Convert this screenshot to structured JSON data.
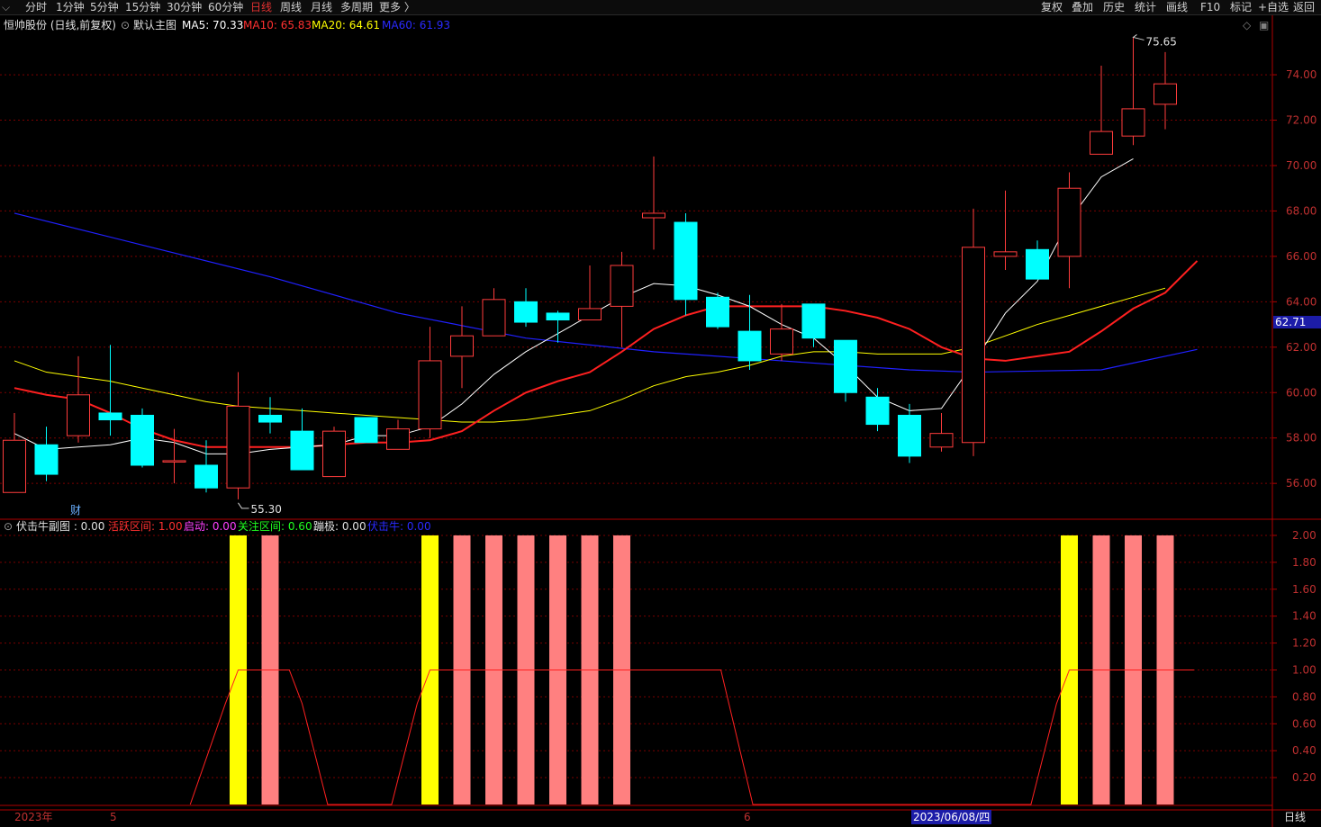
{
  "toolbar": {
    "period_tabs": [
      "分时",
      "1分钟",
      "5分钟",
      "15分钟",
      "30分钟",
      "60分钟",
      "日线",
      "周线",
      "月线",
      "多周期",
      "更多 〉"
    ],
    "active_tab": "日线",
    "right_buttons": [
      "复权",
      "叠加",
      "历史",
      "统计",
      "画线",
      "F10",
      "标记",
      "+自选",
      "返回"
    ]
  },
  "main_header": {
    "stock": "恒帅股份 (日线,前复权)",
    "template": "默认主图",
    "ma5": "MA5: 70.33",
    "ma10": "MA10: 65.83",
    "ma20": "MA20: 64.61",
    "ma60": "MA60: 61.93"
  },
  "sub_header": {
    "name": "伏击牛副图 : 0.00",
    "active": "活跃区间: 1.00",
    "start": "启动: 0.00",
    "focus": "关注区间: 0.60",
    "jump": "蹦极: 0.00",
    "ambush": "伏击牛: 0.00"
  },
  "price_marks": {
    "high_label": "75.65",
    "low_label": "55.30",
    "current_price": "62.71",
    "fin_marker": "财"
  },
  "axis_labels": {
    "year": "2023年",
    "month5": "5",
    "month6": "6",
    "cursor_date": "2023/06/08/四",
    "period": "日线"
  },
  "colors": {
    "up": "#ff3c3c",
    "down": "#00ffff",
    "ma5": "#ffffff",
    "ma10": "#ff2020",
    "ma20": "#ffff00",
    "ma60": "#2020ff",
    "bar_yellow": "#ffff00",
    "bar_pink": "#ff8080",
    "grid": "#7a0000",
    "axis_text": "#c03030"
  },
  "chart_data": {
    "type": "candlestick",
    "y_range": [
      54.5,
      76.5
    ],
    "y_ticks": [
      56,
      58,
      60,
      62,
      64,
      66,
      68,
      70,
      72,
      74
    ],
    "candles": [
      {
        "o": 55.6,
        "h": 59.1,
        "l": 55.6,
        "c": 57.9
      },
      {
        "o": 57.7,
        "h": 58.5,
        "l": 56.1,
        "c": 56.4
      },
      {
        "o": 58.1,
        "h": 61.6,
        "l": 57.8,
        "c": 59.9
      },
      {
        "o": 59.1,
        "h": 62.1,
        "l": 58.1,
        "c": 58.8
      },
      {
        "o": 59.0,
        "h": 59.3,
        "l": 56.7,
        "c": 56.8
      },
      {
        "o": 57.0,
        "h": 58.4,
        "l": 56.0,
        "c": 57.0
      },
      {
        "o": 56.8,
        "h": 57.9,
        "l": 55.6,
        "c": 55.8
      },
      {
        "o": 55.8,
        "h": 60.9,
        "l": 55.3,
        "c": 59.4
      },
      {
        "o": 59.0,
        "h": 59.8,
        "l": 58.2,
        "c": 58.7
      },
      {
        "o": 58.3,
        "h": 59.3,
        "l": 56.6,
        "c": 56.6
      },
      {
        "o": 56.3,
        "h": 58.5,
        "l": 56.3,
        "c": 58.3
      },
      {
        "o": 58.9,
        "h": 58.9,
        "l": 57.8,
        "c": 57.8
      },
      {
        "o": 57.5,
        "h": 58.8,
        "l": 57.5,
        "c": 58.4
      },
      {
        "o": 58.4,
        "h": 62.9,
        "l": 58.0,
        "c": 61.4
      },
      {
        "o": 61.6,
        "h": 63.8,
        "l": 60.2,
        "c": 62.5
      },
      {
        "o": 62.5,
        "h": 64.6,
        "l": 62.5,
        "c": 64.1
      },
      {
        "o": 64.0,
        "h": 64.6,
        "l": 62.9,
        "c": 63.1
      },
      {
        "o": 63.5,
        "h": 63.6,
        "l": 62.2,
        "c": 63.2
      },
      {
        "o": 63.2,
        "h": 65.6,
        "l": 63.2,
        "c": 63.7
      },
      {
        "o": 63.8,
        "h": 66.2,
        "l": 62.0,
        "c": 65.6
      },
      {
        "o": 67.7,
        "h": 70.4,
        "l": 66.3,
        "c": 67.9
      },
      {
        "o": 67.5,
        "h": 67.9,
        "l": 63.4,
        "c": 64.1
      },
      {
        "o": 64.2,
        "h": 64.4,
        "l": 62.8,
        "c": 62.9
      },
      {
        "o": 62.7,
        "h": 64.3,
        "l": 61.0,
        "c": 61.4
      },
      {
        "o": 61.7,
        "h": 63.9,
        "l": 61.4,
        "c": 62.8
      },
      {
        "o": 63.9,
        "h": 63.9,
        "l": 62.0,
        "c": 62.4
      },
      {
        "o": 62.3,
        "h": 62.3,
        "l": 59.6,
        "c": 60.0
      },
      {
        "o": 59.8,
        "h": 60.2,
        "l": 58.3,
        "c": 58.6
      },
      {
        "o": 59.0,
        "h": 59.5,
        "l": 56.9,
        "c": 57.2
      },
      {
        "o": 57.6,
        "h": 59.1,
        "l": 57.4,
        "c": 58.2
      },
      {
        "o": 57.8,
        "h": 68.1,
        "l": 57.2,
        "c": 66.4
      },
      {
        "o": 66.0,
        "h": 68.9,
        "l": 65.4,
        "c": 66.2
      },
      {
        "o": 66.3,
        "h": 66.7,
        "l": 65.0,
        "c": 65.0
      },
      {
        "o": 66.0,
        "h": 69.7,
        "l": 64.6,
        "c": 69.0
      },
      {
        "o": 70.5,
        "h": 74.4,
        "l": 70.5,
        "c": 71.5
      },
      {
        "o": 71.3,
        "h": 75.65,
        "l": 70.9,
        "c": 72.5
      },
      {
        "o": 72.7,
        "h": 75.0,
        "l": 71.6,
        "c": 73.6
      }
    ],
    "ma5": [
      58.2,
      57.5,
      57.6,
      57.7,
      58.0,
      57.8,
      57.3,
      57.3,
      57.5,
      57.6,
      57.7,
      58.1,
      58.1,
      58.5,
      59.5,
      60.8,
      61.8,
      62.6,
      63.4,
      64.2,
      64.8,
      64.7,
      64.3,
      63.8,
      63.0,
      62.4,
      61.2,
      59.8,
      59.2,
      59.3,
      61.3,
      63.5,
      64.9,
      67.6,
      69.5,
      70.3
    ],
    "ma10": [
      60.2,
      59.9,
      59.7,
      59.1,
      58.4,
      57.9,
      57.6,
      57.6,
      57.6,
      57.6,
      57.7,
      57.8,
      57.8,
      57.9,
      58.3,
      59.2,
      60.0,
      60.5,
      60.9,
      61.8,
      62.8,
      63.4,
      63.8,
      63.8,
      63.8,
      63.8,
      63.6,
      63.3,
      62.8,
      62.0,
      61.5,
      61.4,
      61.6,
      61.8,
      62.7,
      63.7,
      64.4,
      65.8
    ],
    "ma20": [
      61.4,
      60.9,
      60.7,
      60.5,
      60.2,
      59.9,
      59.6,
      59.4,
      59.3,
      59.2,
      59.1,
      59.0,
      58.9,
      58.8,
      58.7,
      58.7,
      58.8,
      59.0,
      59.2,
      59.7,
      60.3,
      60.7,
      60.9,
      61.2,
      61.6,
      61.8,
      61.8,
      61.7,
      61.7,
      61.7,
      62.0,
      62.5,
      63.0,
      63.4,
      63.8,
      64.2,
      64.6
    ],
    "ma60_line": [
      [
        0,
        67.9
      ],
      [
        4,
        66.5
      ],
      [
        8,
        65.1
      ],
      [
        12,
        63.5
      ],
      [
        16,
        62.4
      ],
      [
        20,
        61.8
      ],
      [
        24,
        61.4
      ],
      [
        28,
        61.0
      ],
      [
        30,
        60.9
      ],
      [
        34,
        61.0
      ],
      [
        37,
        61.9
      ]
    ],
    "sub_range": [
      0,
      2.1
    ],
    "sub_ticks": [
      0.2,
      0.4,
      0.6,
      0.8,
      1.0,
      1.2,
      1.4,
      1.6,
      1.8,
      2.0
    ],
    "sub_bars": [
      {
        "i": 7,
        "color": "yellow",
        "v": 2
      },
      {
        "i": 8,
        "color": "pink",
        "v": 2
      },
      {
        "i": 13,
        "color": "yellow",
        "v": 2
      },
      {
        "i": 14,
        "color": "pink",
        "v": 2
      },
      {
        "i": 15,
        "color": "pink",
        "v": 2
      },
      {
        "i": 16,
        "color": "pink",
        "v": 2
      },
      {
        "i": 17,
        "color": "pink",
        "v": 2
      },
      {
        "i": 18,
        "color": "pink",
        "v": 2
      },
      {
        "i": 19,
        "color": "pink",
        "v": 2
      },
      {
        "i": 33,
        "color": "yellow",
        "v": 2
      },
      {
        "i": 34,
        "color": "pink",
        "v": 2
      },
      {
        "i": 35,
        "color": "pink",
        "v": 2
      },
      {
        "i": 36,
        "color": "pink",
        "v": 2
      }
    ],
    "sub_line": [
      [
        5.5,
        0
      ],
      [
        6.6,
        0.75
      ],
      [
        7,
        1.0
      ],
      [
        8.6,
        1.0
      ],
      [
        9,
        0.75
      ],
      [
        9.8,
        0
      ],
      [
        11.8,
        0
      ],
      [
        12.6,
        0.75
      ],
      [
        13,
        1.0
      ],
      [
        22.1,
        1.0
      ],
      [
        23.1,
        0
      ],
      [
        31.8,
        0
      ],
      [
        32.6,
        0.75
      ],
      [
        33,
        1.0
      ],
      [
        36.9,
        1.0
      ]
    ]
  }
}
